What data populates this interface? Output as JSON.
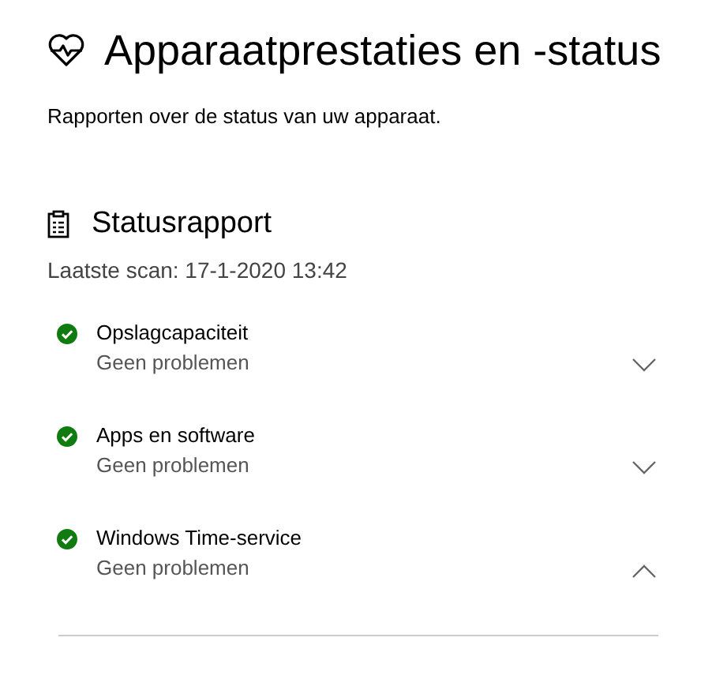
{
  "title": "Apparaatprestaties en -status",
  "subtitle": "Rapporten over de status van uw apparaat.",
  "section": {
    "title": "Statusrapport",
    "last_scan": "Laatste scan: 17-1-2020 13:42"
  },
  "items": [
    {
      "name": "Opslagcapaciteit",
      "status": "Geen problemen",
      "expanded": false
    },
    {
      "name": "Apps en software",
      "status": "Geen problemen",
      "expanded": false
    },
    {
      "name": "Windows Time-service",
      "status": "Geen problemen",
      "expanded": true
    }
  ]
}
